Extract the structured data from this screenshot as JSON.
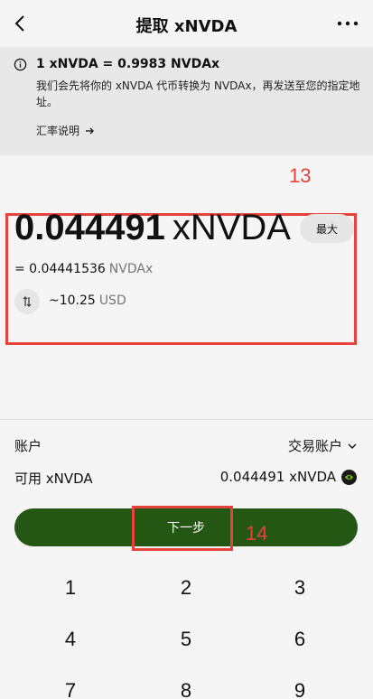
{
  "header": {
    "title": "提取 xNVDA"
  },
  "info": {
    "rate": "1 xNVDA = 0.9983 NVDAx",
    "description": "我们会先将你的 xNVDA 代币转换为 NVDAx，再发送至您的指定地址。",
    "rate_link": "汇率说明"
  },
  "annotations": {
    "label_13": "13",
    "label_14": "14"
  },
  "amount": {
    "value": "0.044491",
    "unit": "xNVDA",
    "max_label": "最大",
    "converted_prefix": "= 0.04441536",
    "converted_unit": "NVDAx",
    "usd_value": "~10.25",
    "usd_unit": "USD"
  },
  "account": {
    "label": "账户",
    "value": "交易账户"
  },
  "available": {
    "label": "可用 xNVDA",
    "value": "0.044491 xNVDA"
  },
  "next_button": "下一步",
  "keypad": [
    "1",
    "2",
    "3",
    "4",
    "5",
    "6",
    "7",
    "8",
    "9"
  ],
  "colors": {
    "accent": "#255714",
    "annotation": "#e4423a"
  }
}
